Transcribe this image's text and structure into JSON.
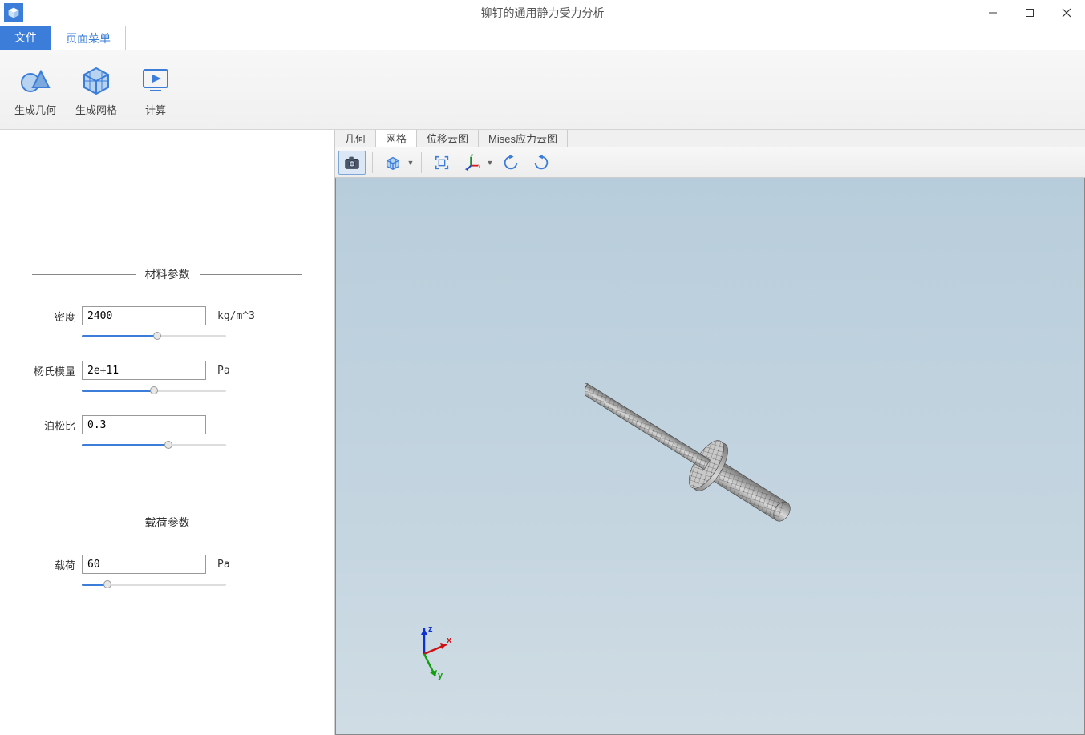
{
  "window": {
    "title": "铆钉的通用静力受力分析"
  },
  "menutabs": {
    "file": "文件",
    "page_menu": "页面菜单"
  },
  "ribbon": {
    "gen_geometry": "生成几何",
    "gen_mesh": "生成网格",
    "compute": "计算"
  },
  "leftpanel": {
    "material_section": "材料参数",
    "load_section": "载荷参数",
    "density": {
      "label": "密度",
      "value": "2400",
      "unit": "kg/m^3",
      "slider_pct": 52
    },
    "youngs": {
      "label": "杨氏模量",
      "value": "2e+11",
      "unit": "Pa",
      "slider_pct": 50
    },
    "poisson": {
      "label": "泊松比",
      "value": "0.3",
      "unit": "",
      "slider_pct": 60
    },
    "load": {
      "label": "载荷",
      "value": "60",
      "unit": "Pa",
      "slider_pct": 18
    }
  },
  "viewtabs": {
    "geometry": "几何",
    "mesh": "网格",
    "displacement": "位移云图",
    "mises": "Mises应力云图"
  },
  "view_toolbar": {
    "camera": "camera-icon",
    "cube": "transparency-icon",
    "extent": "zoom-extent-icon",
    "axes": "axes-icon",
    "rotate_ccw": "rotate-ccw-icon",
    "rotate_cw": "rotate-cw-icon"
  },
  "axis_labels": {
    "x": "x",
    "y": "y",
    "z": "z"
  }
}
